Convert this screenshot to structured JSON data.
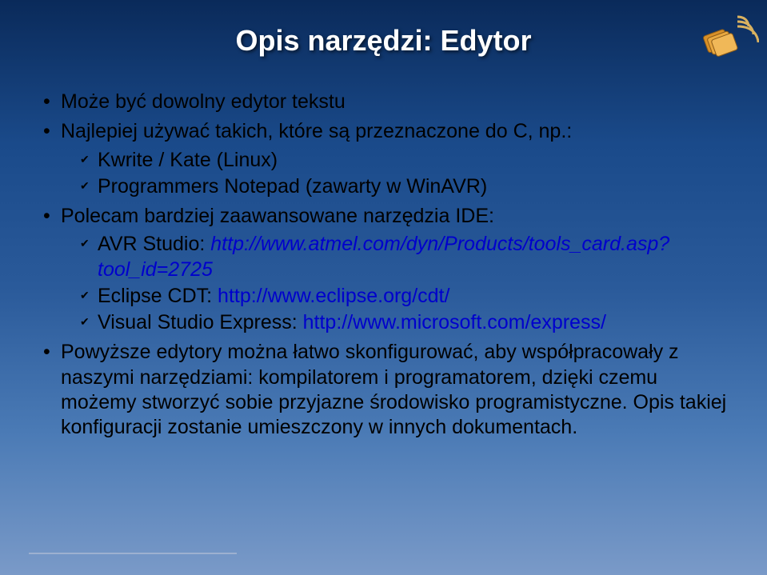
{
  "title": "Opis narzędzi: Edytor",
  "bullets": {
    "b1": "Może być dowolny edytor tekstu",
    "b2": "Najlepiej używać takich, które są przeznaczone do C, np.:",
    "sub": {
      "s1": "Kwrite / Kate (Linux)",
      "s2": "Programmers Notepad (zawarty w WinAVR)",
      "s3_lead": "Polecam bardziej zaawansowane narzędzia IDE:",
      "s4a": "AVR Studio: ",
      "s4b": "http://www.atmel.com/dyn/Products/tools_card.asp?tool_id=2725",
      "s5a": "Eclipse CDT: ",
      "s5b": "http://www.eclipse.org/cdt/",
      "s6a": "Visual Studio Express: ",
      "s6b": "http://www.microsoft.com/express/"
    },
    "b3": "Powyższe edytory można łatwo skonfigurować, aby współpracowały z naszymi narzędziami: kompilatorem i programatorem, dzięki czemu możemy stworzyć sobie przyjazne środowisko programistyczne. Opis takiej konfiguracji zostanie umieszczony w innych dokumentach."
  }
}
